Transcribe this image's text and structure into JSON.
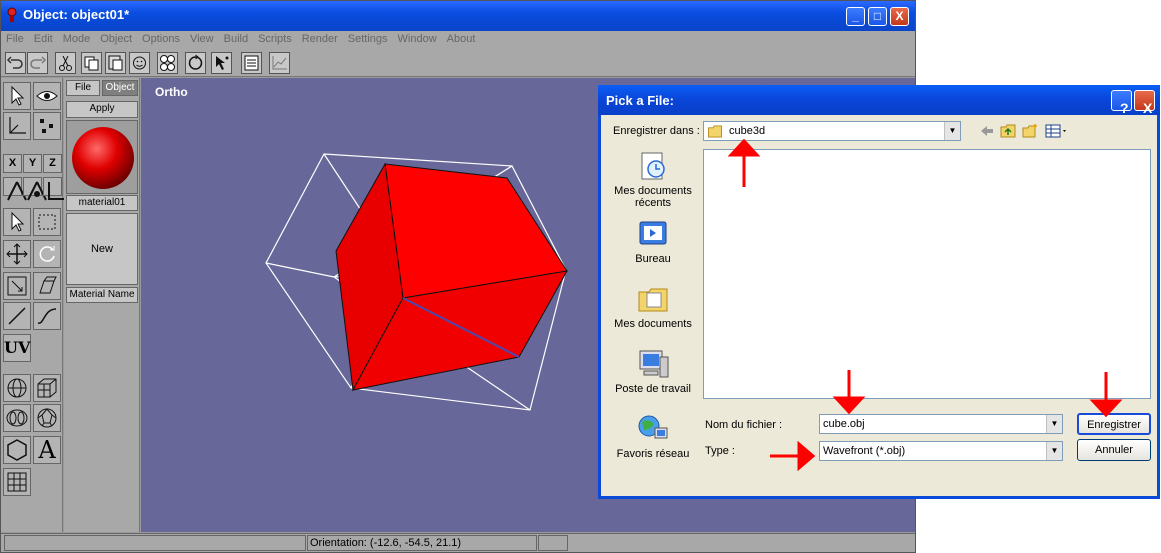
{
  "app": {
    "title": "Object: object01*",
    "menu": [
      "File",
      "Edit",
      "Mode",
      "Object",
      "Options",
      "View",
      "Build",
      "Scripts",
      "Render",
      "Settings",
      "Window",
      "About"
    ],
    "window_buttons": {
      "minimize": "_",
      "maximize": "□",
      "close": "X"
    }
  },
  "material_panel": {
    "tab_file": "File",
    "tab_object": "Object",
    "apply": "Apply",
    "material_name_value": "material01",
    "new_label": "New",
    "material_name_label": "Material Name"
  },
  "left_tools": {
    "x": "X",
    "y": "Y",
    "z": "Z",
    "uv": "UV",
    "text_tool": "A"
  },
  "viewport": {
    "view_label": "Ortho",
    "background": "#67679a",
    "cube_color": "#ff0000"
  },
  "status": {
    "orientation": "Orientation: (-12.6, -54.5, 21.1)"
  },
  "dialog": {
    "title": "Pick a File:",
    "help_button": "?",
    "close_button": "X",
    "save_in_label": "Enregistrer dans :",
    "save_in_value": "cube3d",
    "places": [
      {
        "label": "Mes documents récents",
        "icon": "recent-documents-icon"
      },
      {
        "label": "Bureau",
        "icon": "desktop-icon"
      },
      {
        "label": "Mes documents",
        "icon": "my-documents-icon"
      },
      {
        "label": "Poste de travail",
        "icon": "my-computer-icon"
      },
      {
        "label": "Favoris réseau",
        "icon": "network-places-icon"
      }
    ],
    "filename_label": "Nom du fichier :",
    "filename_value": "cube.obj",
    "type_label": "Type :",
    "type_value": "Wavefront (*.obj)",
    "save_button": "Enregistrer",
    "cancel_button": "Annuler",
    "accent": "#0a4ad8",
    "annotation_color": "#ff0000"
  }
}
